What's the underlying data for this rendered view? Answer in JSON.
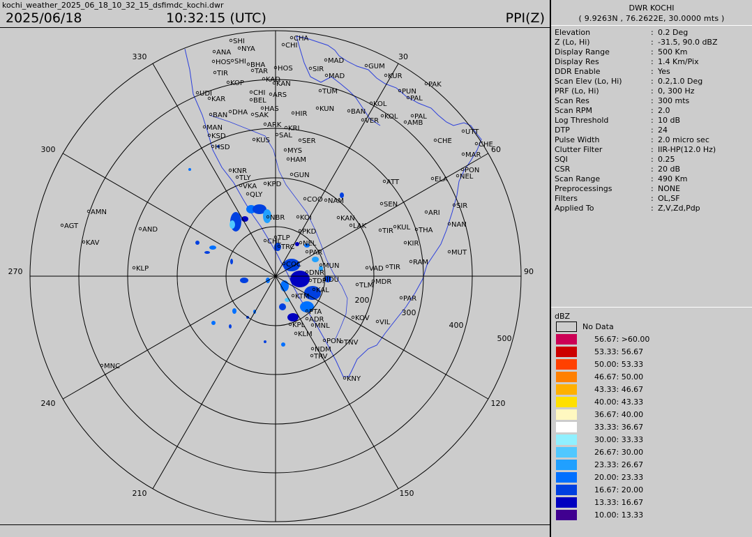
{
  "header": {
    "filename": "kochi_weather_2025_06_18_10_32_15_dsfimdc_kochi.dwr",
    "date": "2025/06/18",
    "time": "10:32:15 (UTC)",
    "product": "PPI(Z)"
  },
  "station": {
    "title": "DWR KOCHI",
    "coords": "( 9.9263N , 76.2622E, 30.0000 mts )"
  },
  "params": [
    {
      "key": "Elevation",
      "value": "0.2 Deg"
    },
    {
      "key": "Z (Lo, Hi)",
      "value": "-31.5, 90.0 dBZ"
    },
    {
      "key": "Display Range",
      "value": "500 Km"
    },
    {
      "key": "Display Res",
      "value": "1.4 Km/Pix"
    },
    {
      "key": "DDR Enable",
      "value": "Yes"
    },
    {
      "key": "Scan Elev (Lo, Hi)",
      "value": "0.2,1.0 Deg"
    },
    {
      "key": "PRF (Lo, Hi)",
      "value": "0, 300 Hz"
    },
    {
      "key": "Scan Res",
      "value": "300 mts"
    },
    {
      "key": "Scan RPM",
      "value": "2.0"
    },
    {
      "key": "Log Threshold",
      "value": "10 dB"
    },
    {
      "key": "DTP",
      "value": "24"
    },
    {
      "key": "Pulse Width",
      "value": "2.0 micro sec"
    },
    {
      "key": "Clutter Filter",
      "value": "IIR-HP(12.0 Hz)"
    },
    {
      "key": "SQI",
      "value": "0.25"
    },
    {
      "key": "CSR",
      "value": "20 dB"
    },
    {
      "key": "Scan Range",
      "value": "490 Km"
    },
    {
      "key": "Preprocessings",
      "value": "NONE"
    },
    {
      "key": "Filters",
      "value": "OL,SF"
    },
    {
      "key": "Applied To",
      "value": "Z,V,Zd,Pdp"
    }
  ],
  "legend": {
    "title": "dBZ",
    "nodata_label": "No Data",
    "items": [
      {
        "label": "56.67: >60.00",
        "color": "#cc0055"
      },
      {
        "label": "53.33: 56.67",
        "color": "#cc0000"
      },
      {
        "label": "50.00: 53.33",
        "color": "#ff4000"
      },
      {
        "label": "46.67: 50.00",
        "color": "#ff8000"
      },
      {
        "label": "43.33: 46.67",
        "color": "#ffb000"
      },
      {
        "label": "40.00: 43.33",
        "color": "#ffe000"
      },
      {
        "label": "36.67: 40.00",
        "color": "#fff8c0"
      },
      {
        "label": "33.33: 36.67",
        "color": "#ffffff"
      },
      {
        "label": "30.00: 33.33",
        "color": "#90f0ff"
      },
      {
        "label": "26.67: 30.00",
        "color": "#50c8ff"
      },
      {
        "label": "23.33: 26.67",
        "color": "#20a0ff"
      },
      {
        "label": "20.00: 23.33",
        "color": "#0070ff"
      },
      {
        "label": "16.67: 20.00",
        "color": "#0040e0"
      },
      {
        "label": "13.33: 16.67",
        "color": "#0000c0"
      },
      {
        "label": "10.00: 13.33",
        "color": "#400090"
      }
    ]
  },
  "radar": {
    "azimuth_labels": [
      {
        "az": 0,
        "text": ""
      },
      {
        "az": 30,
        "text": "30"
      },
      {
        "az": 60,
        "text": "60"
      },
      {
        "az": 90,
        "text": "90"
      },
      {
        "az": 120,
        "text": "120"
      },
      {
        "az": 150,
        "text": "150"
      },
      {
        "az": 180,
        "text": ""
      },
      {
        "az": 210,
        "text": "210"
      },
      {
        "az": 240,
        "text": "240"
      },
      {
        "az": 270,
        "text": "270"
      },
      {
        "az": 300,
        "text": "300"
      },
      {
        "az": 330,
        "text": "330"
      }
    ],
    "range_labels": [
      "200",
      "300",
      "400",
      "500"
    ],
    "cities": [
      {
        "n": "SHI"
      },
      {
        "n": "NYA"
      },
      {
        "n": "ANA"
      },
      {
        "n": "HOS"
      },
      {
        "n": "SHI"
      },
      {
        "n": "BHA"
      },
      {
        "n": "TIR"
      },
      {
        "n": "TAR"
      },
      {
        "n": "HOS"
      },
      {
        "n": "KAD"
      },
      {
        "n": "KAN"
      },
      {
        "n": "KOP"
      },
      {
        "n": "UDI"
      },
      {
        "n": "CHI"
      },
      {
        "n": "ARS"
      },
      {
        "n": "KAR"
      },
      {
        "n": "BEL"
      },
      {
        "n": "HAS"
      },
      {
        "n": "BAN"
      },
      {
        "n": "DHA"
      },
      {
        "n": "SAK"
      },
      {
        "n": "HIR"
      },
      {
        "n": "KUN"
      },
      {
        "n": "BAN"
      },
      {
        "n": "ARK"
      },
      {
        "n": "KRI"
      },
      {
        "n": "MAN"
      },
      {
        "n": "SAL"
      },
      {
        "n": "KSD"
      },
      {
        "n": "KUS"
      },
      {
        "n": "SER"
      },
      {
        "n": "HSD"
      },
      {
        "n": "MYS"
      },
      {
        "n": "HAM"
      },
      {
        "n": "KNR"
      },
      {
        "n": "TLY"
      },
      {
        "n": "GUN"
      },
      {
        "n": "VKA"
      },
      {
        "n": "KPD"
      },
      {
        "n": "QLY"
      },
      {
        "n": "COO"
      },
      {
        "n": "NAM"
      },
      {
        "n": "NBR"
      },
      {
        "n": "KOI"
      },
      {
        "n": "CHA"
      },
      {
        "n": "CHI"
      },
      {
        "n": "MAD"
      },
      {
        "n": "SIR"
      },
      {
        "n": "MAD"
      },
      {
        "n": "GUM"
      },
      {
        "n": "KUR"
      },
      {
        "n": "TUM"
      },
      {
        "n": "PAK"
      },
      {
        "n": "PUN"
      },
      {
        "n": "PAL"
      },
      {
        "n": "KOL"
      },
      {
        "n": "KOL"
      },
      {
        "n": "PAL"
      },
      {
        "n": "VER"
      },
      {
        "n": "AMB"
      },
      {
        "n": "UTT"
      },
      {
        "n": "CHE"
      },
      {
        "n": "CHE"
      },
      {
        "n": "MAR"
      },
      {
        "n": "PON"
      },
      {
        "n": "NEL"
      },
      {
        "n": "ELA"
      },
      {
        "n": "ATT"
      },
      {
        "n": "SEN"
      },
      {
        "n": "ARI"
      },
      {
        "n": "SIR"
      },
      {
        "n": "KAN"
      },
      {
        "n": "LAK"
      },
      {
        "n": "TIR"
      },
      {
        "n": "KUL"
      },
      {
        "n": "THA"
      },
      {
        "n": "NAN"
      },
      {
        "n": "KIR"
      },
      {
        "n": "MUT"
      },
      {
        "n": "RAM"
      },
      {
        "n": "VAD"
      },
      {
        "n": "TIR"
      },
      {
        "n": "TLM"
      },
      {
        "n": "MDR"
      },
      {
        "n": "PAR"
      },
      {
        "n": "KOV"
      },
      {
        "n": "VIL"
      },
      {
        "n": "KNY"
      },
      {
        "n": "TNV"
      },
      {
        "n": "PON"
      },
      {
        "n": "NDM"
      },
      {
        "n": "TRV"
      },
      {
        "n": "KLM"
      },
      {
        "n": "KPL"
      },
      {
        "n": "ADR"
      },
      {
        "n": "MNL"
      },
      {
        "n": "AMN"
      },
      {
        "n": "AGT"
      },
      {
        "n": "AND"
      },
      {
        "n": "KAV"
      },
      {
        "n": "KLP"
      },
      {
        "n": "MNC"
      },
      {
        "n": "NEL"
      },
      {
        "n": "PAR"
      },
      {
        "n": "TLP"
      },
      {
        "n": "CHL"
      },
      {
        "n": "TRC"
      },
      {
        "n": "PKD"
      },
      {
        "n": "IDU"
      },
      {
        "n": "KTM"
      },
      {
        "n": "PTA"
      },
      {
        "n": "COC"
      },
      {
        "n": "MUN"
      },
      {
        "n": "DNR"
      },
      {
        "n": "TDP"
      },
      {
        "n": "KAL"
      }
    ]
  }
}
